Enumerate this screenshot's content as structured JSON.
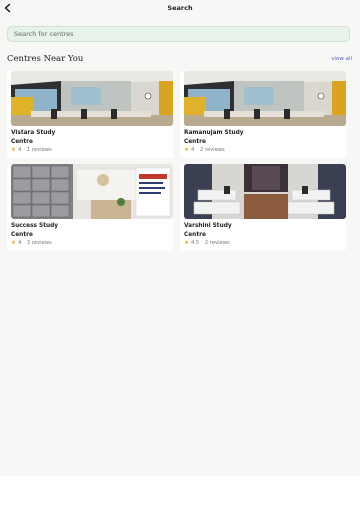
{
  "header": {
    "title": "Search",
    "back_icon": "chevron-left-icon"
  },
  "search": {
    "placeholder": "Search for centres"
  },
  "section": {
    "title": "Centres Near You",
    "view_all": "view all"
  },
  "centres": [
    {
      "name_line1": "Vistara Study",
      "name_line2": "Centre",
      "rating": "4",
      "reviews": "1 reviews",
      "photo": "classroom-photo"
    },
    {
      "name_line1": "Ramanujam Study",
      "name_line2": "Centre",
      "rating": "4",
      "reviews": "2 reviews",
      "photo": "classroom-photo"
    },
    {
      "name_line1": "Success Study",
      "name_line2": "Centre",
      "rating": "4",
      "reviews": "3 reviews",
      "photo": "lockers-reception-photo"
    },
    {
      "name_line1": "Varshini Study",
      "name_line2": "Centre",
      "rating": "4.5",
      "reviews": "2 reviews",
      "photo": "study-cubicles-photo"
    }
  ],
  "colors": {
    "accent": "#5b5bd6",
    "search_bg": "#e7f2e8",
    "star": "#f1a229"
  }
}
